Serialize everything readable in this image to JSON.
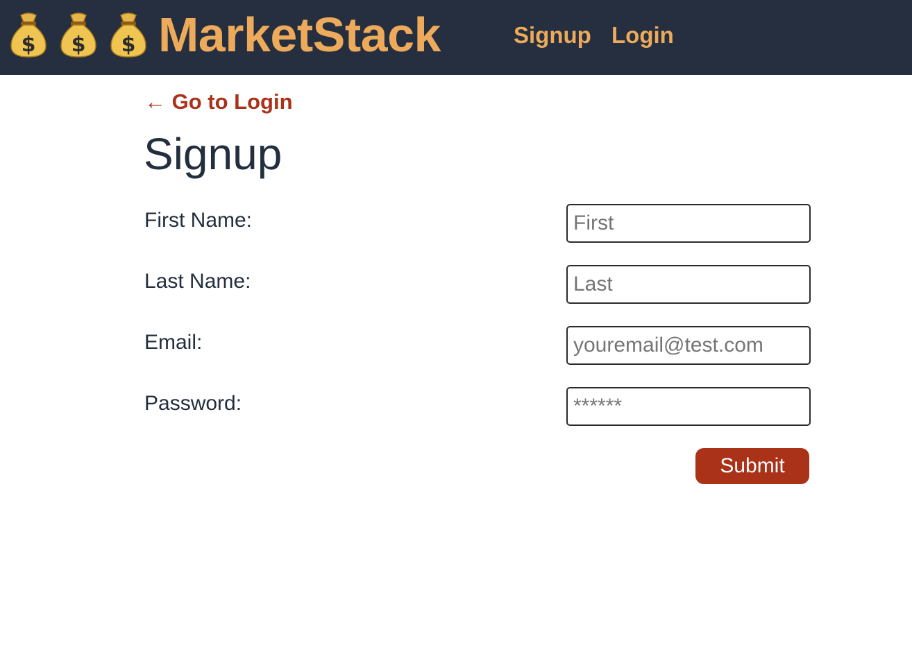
{
  "navbar": {
    "brand_icons": [
      "money-bag-icon",
      "money-bag-icon",
      "money-bag-icon"
    ],
    "brand_name": "MarketStack",
    "links": [
      {
        "label": "Signup"
      },
      {
        "label": "Login"
      }
    ],
    "colors": {
      "background": "#252f3f",
      "accent": "#eeaa5b"
    }
  },
  "main": {
    "back_link": "← Go to Login",
    "title": "Signup",
    "fields": [
      {
        "label": "First Name:",
        "value": "",
        "placeholder": "First",
        "type": "text"
      },
      {
        "label": "Last Name:",
        "value": "",
        "placeholder": "Last",
        "type": "text"
      },
      {
        "label": "Email:",
        "value": "",
        "placeholder": "youremail@test.com",
        "type": "email"
      },
      {
        "label": "Password:",
        "value": "",
        "placeholder": "******",
        "type": "password"
      }
    ],
    "submit_label": "Submit",
    "colors": {
      "text": "#232f3e",
      "accent": "#a93219"
    }
  }
}
